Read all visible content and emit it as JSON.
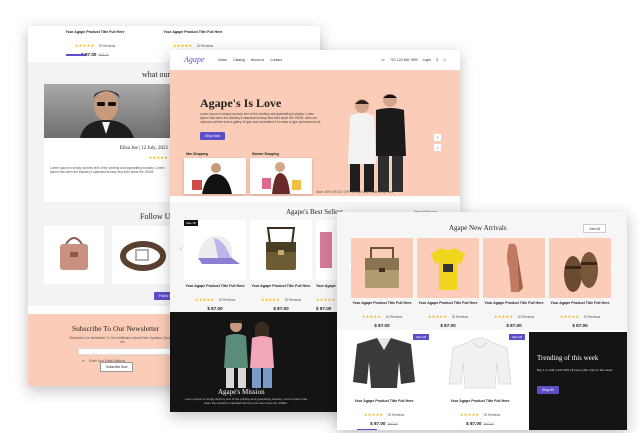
{
  "back_page": {
    "top_products": [
      {
        "title": "Your Agape Product Title Full Here",
        "stars": "★★★★★",
        "reviews": "20 Reviews",
        "price": "$ 87.00",
        "old_price": "$95.00"
      },
      {
        "title": "Your Agape Product Title Full Here",
        "stars": "★★★★★",
        "reviews": "20 Reviews",
        "price": "$ 87.00",
        "old_price": "$95.00"
      }
    ],
    "testimonial_heading": "what our c",
    "testimonial_name": "Elisa Joe | 12 July, 2022",
    "testimonial_stars": "★★★★★",
    "testimonial_text": "Lorem Ipsum is simply dummy text of the printing and typesetting industry. Lorem Ipsum has been the industry's standard dummy text ever since the 1500s.",
    "follow_heading": "Follow Us",
    "follow_btn": "Follow Us",
    "newsletter_heading": "Subscribe To Our Newsletter",
    "newsletter_text": "Subscribe Our Newsletter To Get Notification About New Updates, Discount, etc.",
    "newsletter_placeholder": "Enter Your Email Address",
    "newsletter_btn": "Subscribe Now"
  },
  "middle_page": {
    "logo": "Agape",
    "nav": [
      "Home",
      "Catalog",
      "About us",
      "Contact"
    ],
    "phone": "+01 123 456 7890",
    "login": "Login",
    "hero_title": "Agape's Is Love",
    "hero_text": "Lorem ipsum is simply dummy text of the printing and typesetting industry. Lorem Ipsum has been the industry's standard dummy text ever since the 1500s, when an unknown printer took a galley of type and scrambled it to make a type specimen book.",
    "hero_btn": "Shop Now",
    "cat_men": "Men Shopping",
    "cat_women": "Women Shopping",
    "promo_text": "Save 15% Off OUT OFF for first Order Sale Shop Now",
    "best_sellers_title": "Agape's Best Sellers",
    "view_all": "View All Product",
    "sale_badge": "Sale Off",
    "products": [
      {
        "title": "Your Agape Product Title Full Here",
        "stars": "★★★★★",
        "reviews": "20 Reviews",
        "price": "$ 87.00"
      },
      {
        "title": "Your Agape Product Title Full Here",
        "stars": "★★★★★",
        "reviews": "20 Reviews",
        "price": "$ 87.00"
      },
      {
        "title": "Your Agape",
        "stars": "★★★★★",
        "reviews": "",
        "price": "$ 87.00"
      }
    ],
    "mission_title": "Agape's Mission",
    "mission_text": "Lorem ipsum is simply dummy text of the printing and typesetting industry. Lorem Ipsum has been the industry's standard dummy text ever since the 1500s."
  },
  "front_page": {
    "new_arrivals_title": "Agape New Arrivals",
    "view_all": "View All",
    "products": [
      {
        "title": "Your Agape Product Title Full Here",
        "stars": "★★★★★",
        "reviews": "20 Reviews",
        "price": "$ 87.00"
      },
      {
        "title": "Your Agape Product Title Full Here",
        "stars": "★★★★★",
        "reviews": "20 Reviews",
        "price": "$ 87.00"
      },
      {
        "title": "Your Agape Product Title Full Here",
        "stars": "★★★★★",
        "reviews": "20 Reviews",
        "price": "$ 87.00"
      },
      {
        "title": "Your Agape Product Title Full Here",
        "stars": "★★★★★",
        "reviews": "20 Reviews",
        "price": "$ 87.00"
      }
    ],
    "bottom_products": [
      {
        "badge": "Sale Off",
        "title": "Your Agape Product Title Full Here",
        "stars": "★★★★★",
        "reviews": "20 Reviews",
        "price": "$ 87.00",
        "old_price": "$95.00"
      },
      {
        "badge": "Sale Off",
        "title": "Your Agape Product Title Full Here",
        "stars": "★★★★★",
        "reviews": "20 Reviews",
        "price": "$ 87.00",
        "old_price": "$95.00"
      }
    ],
    "trending_title": "Trending of this week",
    "trending_text": "Buy 1 or Add it and 30% off every offer only for this week",
    "trending_btn": "Shop All"
  },
  "colors": {
    "accent": "#5b4fc8",
    "salmon": "#fbcdb8",
    "dark": "#141414",
    "star": "#f5b400"
  }
}
